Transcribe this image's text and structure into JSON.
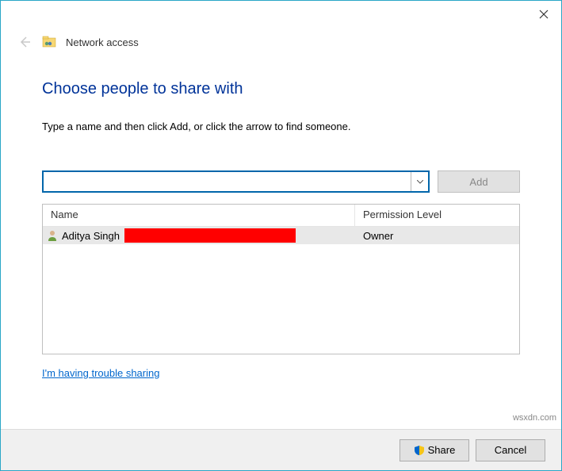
{
  "header": {
    "title": "Network access"
  },
  "main": {
    "heading": "Choose people to share with",
    "instruction": "Type a name and then click Add, or click the arrow to find someone.",
    "input_value": "",
    "add_label": "Add"
  },
  "table": {
    "columns": {
      "name": "Name",
      "permission": "Permission Level"
    },
    "rows": [
      {
        "name": "Aditya Singh",
        "permission": "Owner"
      }
    ]
  },
  "help_link": "I'm having trouble sharing",
  "footer": {
    "share": "Share",
    "cancel": "Cancel"
  },
  "watermark": "wsxdn.com"
}
